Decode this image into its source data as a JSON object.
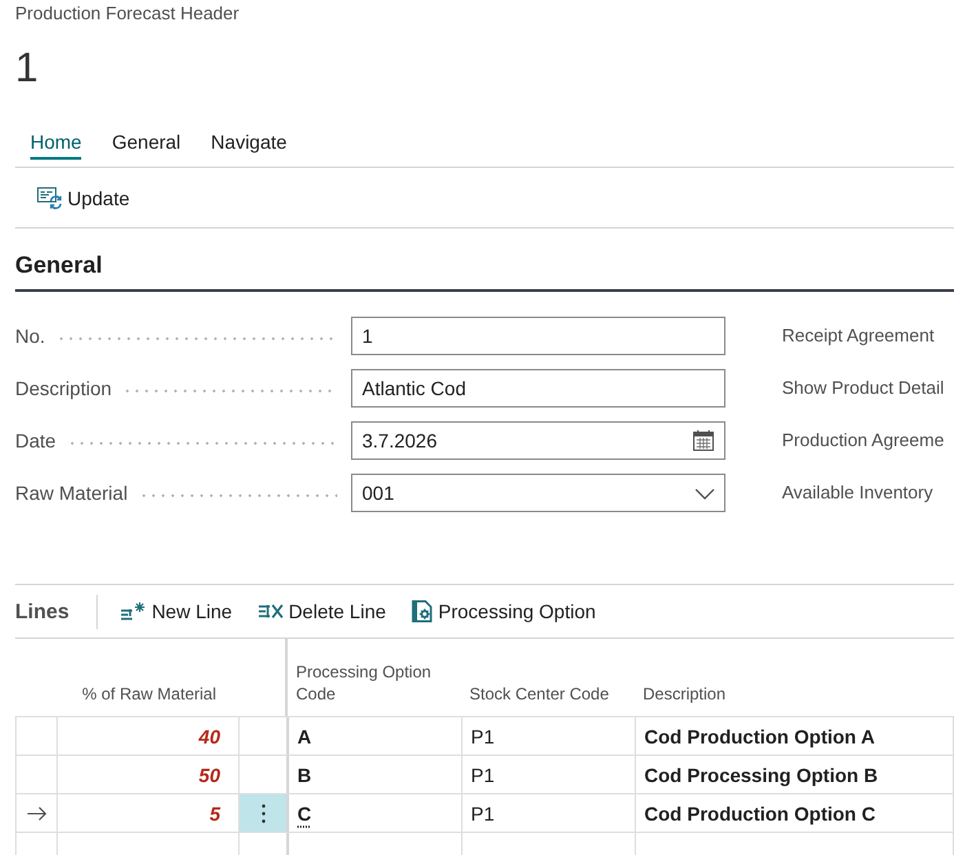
{
  "caption": "Production Forecast Header",
  "title": "1",
  "tabs": [
    {
      "label": "Home",
      "selected": true
    },
    {
      "label": "General",
      "selected": false
    },
    {
      "label": "Navigate",
      "selected": false
    }
  ],
  "actions": [
    {
      "kind": "update",
      "label": "Update"
    }
  ],
  "general": {
    "title": "General",
    "fields": [
      {
        "kind": "text",
        "label": "No.",
        "value": "1"
      },
      {
        "kind": "text",
        "label": "Description",
        "value": "Atlantic Cod"
      },
      {
        "kind": "date",
        "label": "Date",
        "value": "3.7.2026"
      },
      {
        "kind": "dropdown",
        "label": "Raw Material",
        "value": "001"
      }
    ],
    "right_labels": [
      "Receipt Agreement",
      "Show Product Detail",
      "Production Agreeme",
      "Available Inventory"
    ]
  },
  "lines": {
    "title": "Lines",
    "actions": [
      {
        "kind": "new",
        "label": "New Line"
      },
      {
        "kind": "delete",
        "label": "Delete Line"
      },
      {
        "kind": "option",
        "label": "Processing Option"
      }
    ],
    "columns": [
      "% of Raw Material",
      "Processing Option Code",
      "Stock Center Code",
      "Description"
    ],
    "rows": [
      {
        "current": false,
        "percent": "40",
        "code": "A",
        "stock": "P1",
        "description": "Cod Production Option A"
      },
      {
        "current": false,
        "percent": "50",
        "code": "B",
        "stock": "P1",
        "description": "Cod Processing Option B"
      },
      {
        "current": true,
        "percent": "5",
        "code": "C",
        "stock": "P1",
        "description": "Cod Production Option C"
      }
    ]
  }
}
